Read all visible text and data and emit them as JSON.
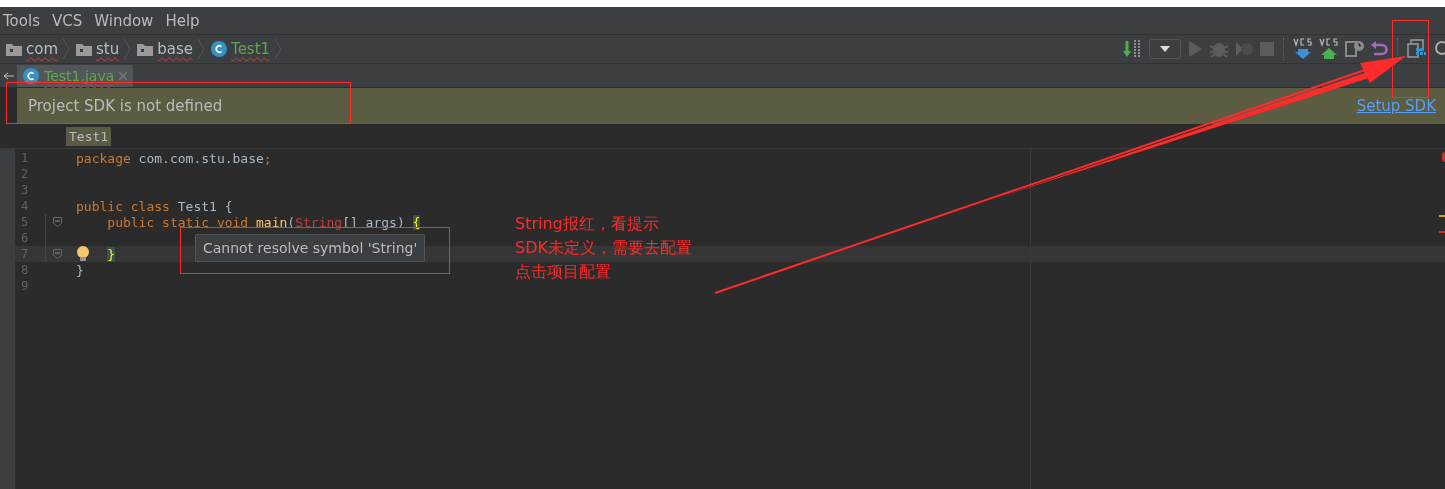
{
  "menu": [
    {
      "label": "Tools"
    },
    {
      "label": "VCS"
    },
    {
      "label": "Window"
    },
    {
      "label": "Help"
    }
  ],
  "navbar": {
    "breadcrumbs": [
      {
        "label": "com",
        "kind": "package",
        "error": true
      },
      {
        "label": "stu",
        "kind": "package",
        "error": true
      },
      {
        "label": "base",
        "kind": "package",
        "error": true
      },
      {
        "label": "Test1",
        "kind": "class",
        "error": true
      }
    ]
  },
  "tabs": [
    {
      "label": "Test1.java",
      "selected": true,
      "error": true
    }
  ],
  "banner": {
    "message": "Project SDK is not defined",
    "link": "Setup SDK"
  },
  "editor": {
    "breadcrumb": "Test1",
    "lines": [
      {
        "number": "1",
        "current": false,
        "fold": false,
        "bulb": false,
        "tokens": [
          {
            "text": "package",
            "kind": "keyword"
          },
          {
            "text": " com.com.stu.base",
            "kind": "plain"
          },
          {
            "text": ";",
            "kind": "keyword"
          }
        ]
      },
      {
        "number": "2",
        "current": false,
        "fold": false,
        "bulb": false
      },
      {
        "number": "3",
        "current": false,
        "fold": false,
        "bulb": false
      },
      {
        "number": "4",
        "current": false,
        "fold": false,
        "bulb": false,
        "tokens": [
          {
            "text": "public class ",
            "kind": "keyword"
          },
          {
            "text": "Test1",
            "kind": "plain"
          },
          {
            "text": " {",
            "kind": "plain"
          }
        ]
      },
      {
        "number": "5",
        "current": false,
        "fold": true,
        "bulb": false,
        "tokens": [
          {
            "text": "    public static void ",
            "kind": "keyword"
          },
          {
            "text": "main",
            "kind": "method"
          },
          {
            "text": "(",
            "kind": "plain"
          },
          {
            "text": "String",
            "kind": "error"
          },
          {
            "text": "[] args) ",
            "kind": "plain"
          },
          {
            "text": "{",
            "kind": "brace"
          }
        ]
      },
      {
        "number": "6",
        "current": false,
        "fold": false,
        "bulb": false
      },
      {
        "number": "7",
        "current": true,
        "fold": true,
        "bulb": true,
        "indented": true,
        "tokens": [
          {
            "text": "}",
            "kind": "brace"
          }
        ]
      },
      {
        "number": "8",
        "current": false,
        "fold": false,
        "bulb": false,
        "tokens": [
          {
            "text": "}",
            "kind": "plain"
          }
        ]
      },
      {
        "number": "9",
        "current": false,
        "fold": false,
        "bulb": false
      }
    ],
    "tooltip": "Cannot resolve symbol 'String'"
  },
  "annotation": {
    "lines": [
      "String报红，看提示",
      "SDK未定义，需要去配置",
      "点击项目配置"
    ]
  }
}
